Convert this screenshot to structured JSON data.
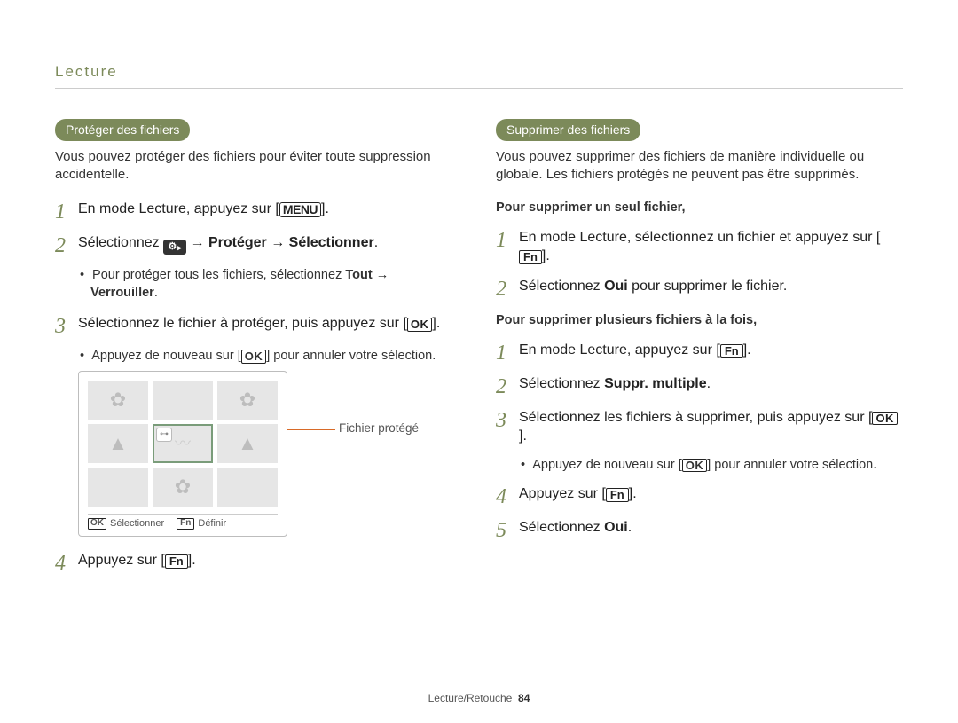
{
  "header": {
    "title": "Lecture"
  },
  "left_col": {
    "pill": "Protéger des fichiers",
    "intro": "Vous pouvez protéger des fichiers pour éviter toute suppression accidentelle.",
    "step1": "En mode Lecture, appuyez sur ",
    "step1_key": "MENU",
    "step2_pre": "Sélectionnez ",
    "step2_iconname": "settings-play-icon",
    "step2_mid1": " Protéger ",
    "step2_mid2": " Sélectionner",
    "step2_post": ".",
    "arrow": "→",
    "sub2_pre": "Pour protéger tous les fichiers, sélectionnez ",
    "sub2_b1": "Tout",
    "sub2_b2": "Verrouiller",
    "sub2_post": ".",
    "step3_pre": "Sélectionnez le fichier à protéger, puis appuyez sur ",
    "step3_key": "OK",
    "step3_post": ".",
    "sub3_pre": "Appuyez de nouveau sur ",
    "sub3_key": "OK",
    "sub3_post": " pour annuler votre sélection.",
    "device": {
      "callout": "Fichier protégé",
      "footer_ok": "OK",
      "footer_ok_label": "Sélectionner",
      "footer_fn": "Fn",
      "footer_fn_label": "Définir"
    },
    "step4_pre": "Appuyez sur ",
    "step4_key": "Fn",
    "step4_post": "."
  },
  "right_col": {
    "pill": "Supprimer des fichiers",
    "intro": "Vous pouvez supprimer des fichiers de manière individuelle ou globale. Les fichiers protégés ne peuvent pas être supprimés.",
    "subhead1": "Pour supprimer un seul fichier,",
    "s1_step1_pre": "En mode Lecture, sélectionnez un fichier et appuyez sur ",
    "s1_step1_key": "Fn",
    "s1_step1_post": ".",
    "s1_step2_pre": "Sélectionnez ",
    "s1_step2_b": "Oui",
    "s1_step2_post": " pour supprimer le fichier.",
    "subhead2": "Pour supprimer plusieurs fichiers à la fois,",
    "s2_step1_pre": "En mode Lecture, appuyez sur ",
    "s2_step1_key": "Fn",
    "s2_step1_post": ".",
    "s2_step2_pre": "Sélectionnez ",
    "s2_step2_b": "Suppr. multiple",
    "s2_step2_post": ".",
    "s2_step3_pre": "Sélectionnez les fichiers à supprimer, puis appuyez sur ",
    "s2_step3_key": "OK",
    "s2_step3_post": ".",
    "s2_sub3_pre": "Appuyez de nouveau sur ",
    "s2_sub3_key": "OK",
    "s2_sub3_post": " pour annuler votre sélection.",
    "s2_step4_pre": "Appuyez sur ",
    "s2_step4_key": "Fn",
    "s2_step4_post": ".",
    "s2_step5_pre": "Sélectionnez ",
    "s2_step5_b": "Oui",
    "s2_step5_post": "."
  },
  "footer": {
    "section": "Lecture/Retouche",
    "page_no": "84"
  }
}
